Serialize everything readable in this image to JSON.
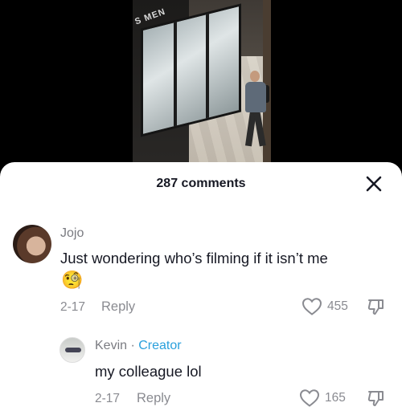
{
  "video": {
    "store_sign": "S MEN"
  },
  "sheet": {
    "title": "287 comments",
    "close_icon": "close-icon"
  },
  "comments": [
    {
      "username": "Jojo",
      "text": "Just wondering who’s filming if it isn’t me",
      "emoji": "🧐",
      "date": "2-17",
      "reply_label": "Reply",
      "likes": "455"
    }
  ],
  "replies": [
    {
      "username": "Kevin",
      "separator": " · ",
      "badge": "Creator",
      "text": "my colleague lol",
      "date": "2-17",
      "reply_label": "Reply",
      "likes": "165"
    }
  ],
  "colors": {
    "creator_badge": "#2aa0dc",
    "text_primary": "#161823",
    "text_secondary": "#8a8b91"
  }
}
